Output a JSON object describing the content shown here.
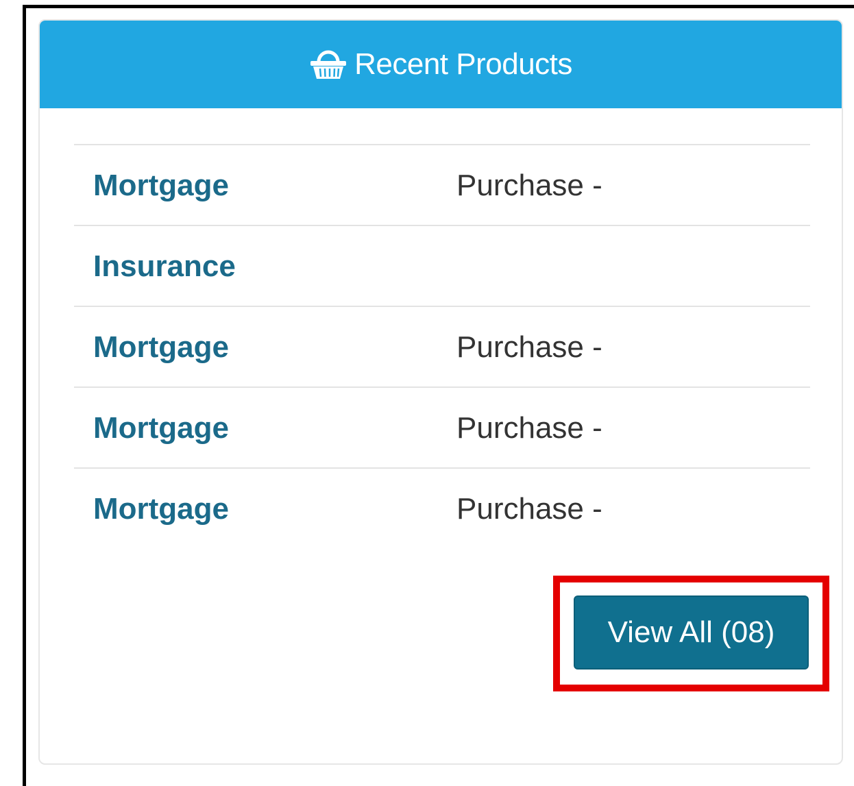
{
  "header": {
    "icon": "shopping-basket-icon",
    "title": "Recent Products"
  },
  "products": [
    {
      "name": "Mortgage",
      "description": "Purchase -"
    },
    {
      "name": "Insurance",
      "description": ""
    },
    {
      "name": "Mortgage",
      "description": "Purchase -"
    },
    {
      "name": "Mortgage",
      "description": "Purchase -"
    },
    {
      "name": "Mortgage",
      "description": "Purchase -"
    }
  ],
  "view_all": {
    "label": "View All (08)"
  },
  "colors": {
    "header_bg": "#21a7e1",
    "product_name": "#1b6a8a",
    "button_bg": "#10708f",
    "highlight": "#e40000"
  }
}
